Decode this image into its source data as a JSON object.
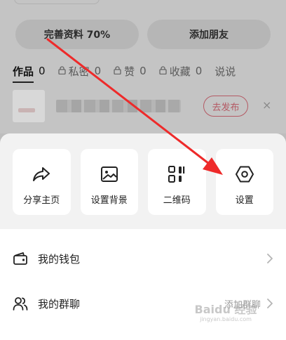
{
  "background": {
    "edit_profile_label": "完善资料 70%",
    "add_friend_label": "添加朋友",
    "tabs": [
      {
        "label": "作品",
        "count": "0",
        "locked": false
      },
      {
        "label": "私密",
        "count": "0",
        "locked": true
      },
      {
        "label": "赞",
        "count": "0",
        "locked": true
      },
      {
        "label": "收藏",
        "count": "0",
        "locked": true
      },
      {
        "label": "说说",
        "count": "",
        "locked": false
      }
    ],
    "publish_label": "去发布",
    "close_glyph": "×"
  },
  "sheet": {
    "tiles": [
      {
        "label": "分享主页",
        "icon": "share-arrow-icon"
      },
      {
        "label": "设置背景",
        "icon": "image-icon"
      },
      {
        "label": "二维码",
        "icon": "qr-code-icon"
      },
      {
        "label": "设置",
        "icon": "hexagon-gear-icon"
      }
    ],
    "rows": [
      {
        "label": "我的钱包",
        "icon": "wallet-icon",
        "sub": ""
      },
      {
        "label": "我的群聊",
        "icon": "group-icon",
        "sub": "添加群聊"
      }
    ]
  },
  "annotation": {
    "color": "#ee2a2a"
  },
  "watermark": {
    "brand": "Baidu 经验",
    "url": "jingyan.baidu.com"
  },
  "colors": {
    "publish_accent": "#b45a64"
  }
}
